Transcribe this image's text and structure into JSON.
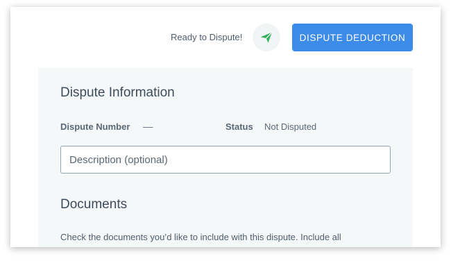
{
  "header": {
    "ready_text": "Ready to Dispute!",
    "status_icon": "paper-plane-icon",
    "dispute_button_label": "DISPUTE DEDUCTION",
    "colors": {
      "accent_button": "#3d8be8",
      "plane_icon": "#35b05a"
    }
  },
  "dispute_info": {
    "title": "Dispute Information",
    "number_label": "Dispute Number",
    "number_value": "––",
    "status_label": "Status",
    "status_value": "Not Disputed",
    "description": {
      "value": "",
      "placeholder": "Description (optional)"
    }
  },
  "documents": {
    "title": "Documents",
    "description": "Check the documents you’d like to include with this dispute. Include all"
  }
}
